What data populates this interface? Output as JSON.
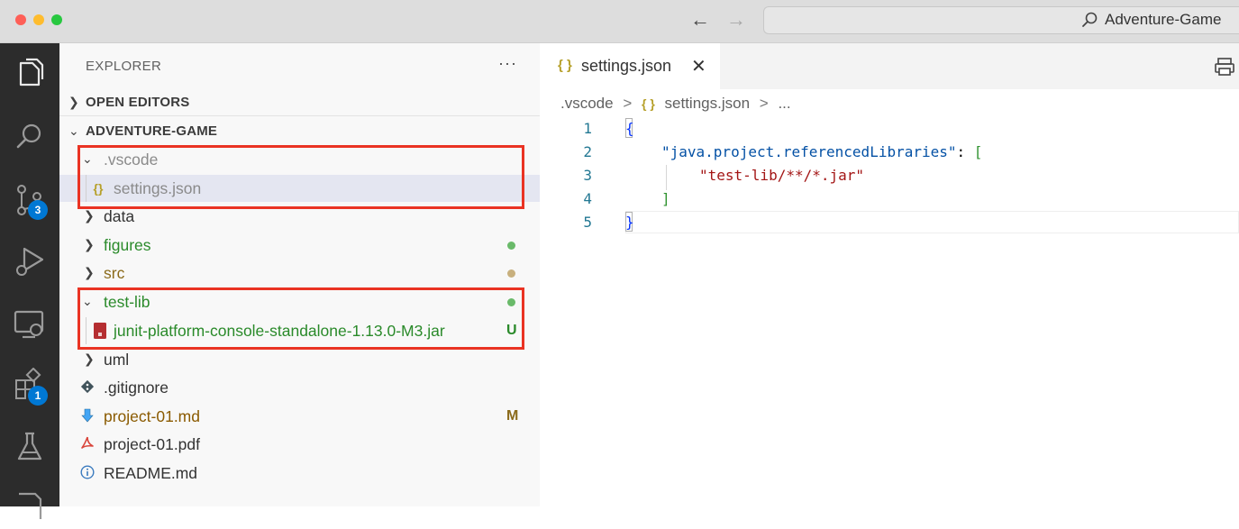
{
  "titlebar": {
    "search_text": "Adventure-Game"
  },
  "activity_bar": {
    "scm_badge": "3",
    "extensions_badge": "1"
  },
  "explorer": {
    "title": "EXPLORER",
    "more_actions": "···",
    "open_editors_label": "OPEN EDITORS",
    "project_label": "ADVENTURE-GAME",
    "tree": [
      {
        "name": ".vscode",
        "kind": "folder",
        "expanded": true,
        "color": "#8a8a8a"
      },
      {
        "name": "settings.json",
        "kind": "file",
        "icon": "json-icon",
        "color": "#8a8a8a",
        "selected": true
      },
      {
        "name": "data",
        "kind": "folder",
        "expanded": false,
        "color": "#333333"
      },
      {
        "name": "figures",
        "kind": "folder",
        "expanded": false,
        "color": "#2a8a2a",
        "decoration": "dot",
        "decoration_color": "#6aba6a"
      },
      {
        "name": "src",
        "kind": "folder",
        "expanded": false,
        "color": "#8a6a1a",
        "decoration": "dot",
        "decoration_color": "#c8b07e"
      },
      {
        "name": "test-lib",
        "kind": "folder",
        "expanded": true,
        "color": "#2a8a2a",
        "decoration": "dot",
        "decoration_color": "#6aba6a"
      },
      {
        "name": "junit-platform-console-standalone-1.13.0-M3.jar",
        "kind": "file",
        "icon": "jar-icon",
        "color": "#2a8a2a",
        "status": "U",
        "status_color": "#2a8a2a"
      },
      {
        "name": "uml",
        "kind": "folder",
        "expanded": false,
        "color": "#333333"
      },
      {
        "name": ".gitignore",
        "kind": "file",
        "icon": "git-icon",
        "color": "#333333"
      },
      {
        "name": "project-01.md",
        "kind": "file",
        "icon": "markdown-icon",
        "color": "#8a5a00",
        "status": "M",
        "status_color": "#8a6a1a"
      },
      {
        "name": "project-01.pdf",
        "kind": "file",
        "icon": "pdf-icon",
        "color": "#333333"
      },
      {
        "name": "README.md",
        "kind": "file",
        "icon": "info-icon",
        "color": "#333333"
      }
    ]
  },
  "editor": {
    "tab_icon": "{ }",
    "tab_label": "settings.json",
    "tab_close": "✕",
    "breadcrumb": {
      "folder": ".vscode",
      "sep": ">",
      "icon": "{ }",
      "file": "settings.json",
      "more": "..."
    },
    "line_numbers": [
      "1",
      "2",
      "3",
      "4",
      "5"
    ],
    "code": {
      "l1_open": "{",
      "l2_key": "\"java.project.referencedLibraries\"",
      "l2_colon": ": ",
      "l2_bracket": "[",
      "l3_value": "\"test-lib/**/*.jar\"",
      "l4_bracket": "]",
      "l5_close": "}"
    }
  }
}
